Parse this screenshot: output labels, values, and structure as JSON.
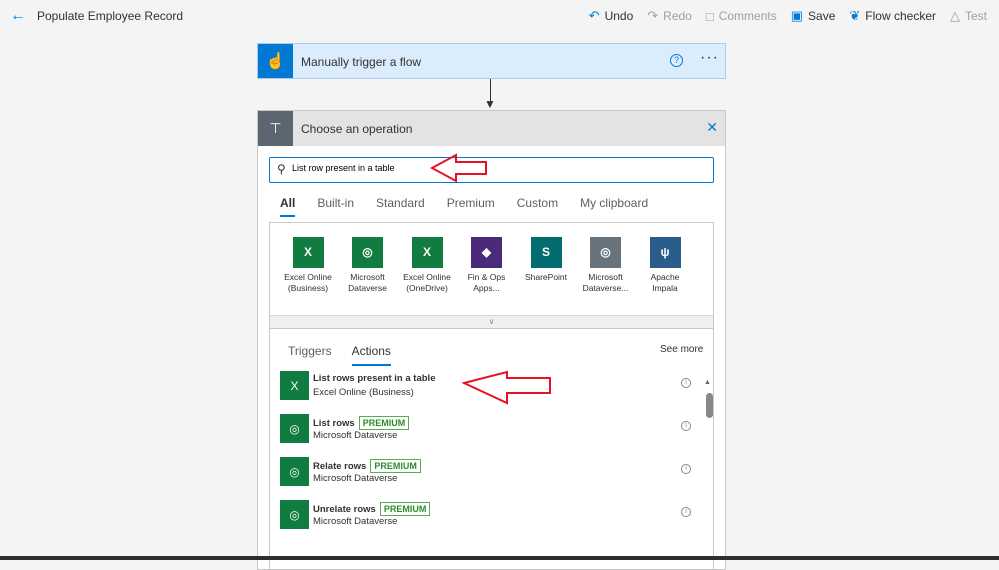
{
  "header": {
    "title": "Populate Employee Record",
    "commands": [
      {
        "label": "Undo",
        "icon": "undo-icon",
        "enabled": true
      },
      {
        "label": "Redo",
        "icon": "redo-icon",
        "enabled": false
      },
      {
        "label": "Comments",
        "icon": "comment-icon",
        "enabled": false
      },
      {
        "label": "Save",
        "icon": "save-icon",
        "enabled": true
      },
      {
        "label": "Flow checker",
        "icon": "stethoscope-icon",
        "enabled": true
      },
      {
        "label": "Test",
        "icon": "flask-icon",
        "enabled": false
      }
    ]
  },
  "trigger": {
    "label": "Manually trigger a flow"
  },
  "operation": {
    "title": "Choose an operation",
    "search": {
      "value": "List row present in a table"
    },
    "tabs": [
      "All",
      "Built-in",
      "Standard",
      "Premium",
      "Custom",
      "My clipboard"
    ],
    "connectors": [
      {
        "line1": "Excel Online",
        "line2": "(Business)",
        "color": "#107c41",
        "glyph": "X"
      },
      {
        "line1": "Microsoft",
        "line2": "Dataverse",
        "color": "#107c41",
        "glyph": "◎"
      },
      {
        "line1": "Excel Online",
        "line2": "(OneDrive)",
        "color": "#107c41",
        "glyph": "X"
      },
      {
        "line1": "Fin & Ops",
        "line2": "Apps...",
        "color": "#4b2a7a",
        "glyph": "◆"
      },
      {
        "line1": "SharePoint",
        "line2": "",
        "color": "#036c70",
        "glyph": "S"
      },
      {
        "line1": "Microsoft",
        "line2": "Dataverse...",
        "color": "#69737c",
        "glyph": "◎"
      },
      {
        "line1": "Apache",
        "line2": "Impala",
        "color": "#2b5d8c",
        "glyph": "ψ"
      }
    ],
    "lower_tabs": [
      "Triggers",
      "Actions"
    ],
    "see_more": "See more",
    "actions": [
      {
        "name": "List rows present in a table",
        "connector": "Excel Online (Business)",
        "badge": "",
        "glyph": "X"
      },
      {
        "name": "List rows",
        "connector": "Microsoft Dataverse",
        "badge": "PREMIUM",
        "glyph": "◎"
      },
      {
        "name": "Relate rows",
        "connector": "Microsoft Dataverse",
        "badge": "PREMIUM",
        "glyph": "◎"
      },
      {
        "name": "Unrelate rows",
        "connector": "Microsoft Dataverse",
        "badge": "PREMIUM",
        "glyph": "◎"
      }
    ]
  },
  "colors": {
    "accent": "#0078d4",
    "premium": "#2e8b2e",
    "annotation": "#e81123"
  }
}
